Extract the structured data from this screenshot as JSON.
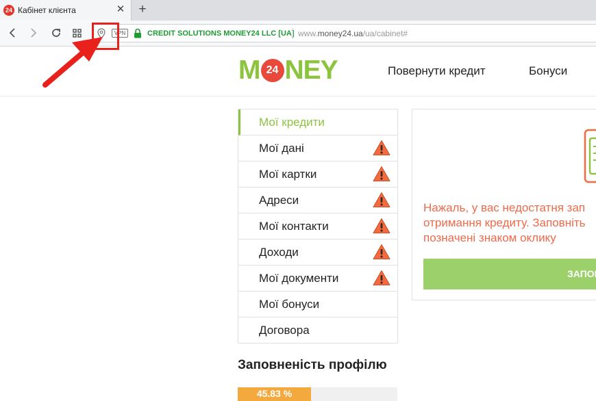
{
  "browser": {
    "tab_title": "Кабінет клієнта",
    "favicon_text": "24",
    "tab_close_glyph": "✕",
    "new_tab_glyph": "+",
    "vpn_label": "VPN",
    "site_identity": "CREDIT SOLUTIONS MONEY24 LLC [UA]",
    "url_prefix": "www.",
    "url_domain": "money24.ua",
    "url_path": "/ua/cabinet#"
  },
  "header": {
    "logo_left": "M",
    "logo_mid": "24",
    "logo_right": "NEY",
    "nav": [
      "Повернути кредит",
      "Бонуси"
    ]
  },
  "side_menu": {
    "items": [
      {
        "label": "Мої кредити",
        "active": true,
        "warning": false
      },
      {
        "label": "Мої дані",
        "active": false,
        "warning": true
      },
      {
        "label": "Мої картки",
        "active": false,
        "warning": true
      },
      {
        "label": "Адреси",
        "active": false,
        "warning": true
      },
      {
        "label": "Мої контакти",
        "active": false,
        "warning": true
      },
      {
        "label": "Доходи",
        "active": false,
        "warning": true
      },
      {
        "label": "Мої документи",
        "active": false,
        "warning": true
      },
      {
        "label": "Мої бонуси",
        "active": false,
        "warning": false
      },
      {
        "label": "Договора",
        "active": false,
        "warning": false
      }
    ]
  },
  "profile": {
    "title": "Заповненість профілю",
    "progress_text": "45.83 %",
    "progress_percent": 45.83
  },
  "notice": {
    "lines": [
      "Нажаль, у вас недостатня зап",
      "отримання кредиту. Заповніть",
      "позначені знаком оклику"
    ],
    "button_label": "ЗАПОВ"
  },
  "colors": {
    "brand_green": "#8cc43f",
    "brand_red": "#e8493a",
    "warning_orange": "#f26a3d",
    "annotation_red": "#e8211c",
    "progress_orange": "#f3a93d"
  },
  "icons": [
    "back-icon",
    "forward-icon",
    "reload-icon",
    "speed-dial-icon",
    "location-pin-icon",
    "lock-icon",
    "warning-icon"
  ]
}
